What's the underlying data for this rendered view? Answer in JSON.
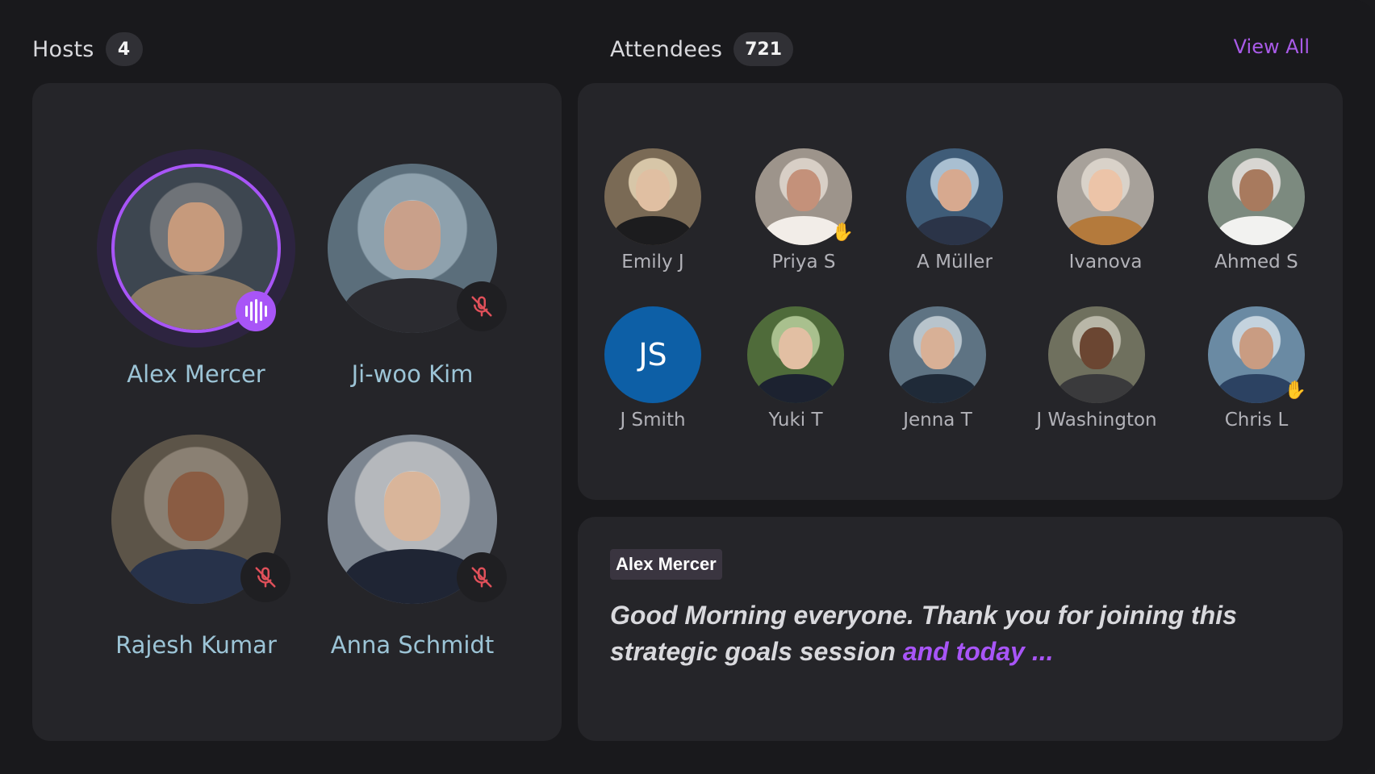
{
  "hosts": {
    "title": "Hosts",
    "count": "4",
    "items": [
      {
        "name": "Alex Mercer",
        "status": "speaking"
      },
      {
        "name": "Ji-woo Kim",
        "status": "muted"
      },
      {
        "name": "Rajesh Kumar",
        "status": "muted"
      },
      {
        "name": "Anna Schmidt",
        "status": "muted"
      }
    ]
  },
  "attendees": {
    "title": "Attendees",
    "count": "721",
    "view_all_label": "View All",
    "items": [
      {
        "name": "Emily J",
        "hand_raised": false
      },
      {
        "name": "Priya S",
        "hand_raised": true
      },
      {
        "name": "A Müller",
        "hand_raised": false
      },
      {
        "name": "Ivanova",
        "hand_raised": false
      },
      {
        "name": "Ahmed S",
        "hand_raised": false
      },
      {
        "name": "J Smith",
        "initials": "JS",
        "hand_raised": false
      },
      {
        "name": "Yuki T",
        "hand_raised": false
      },
      {
        "name": "Jenna T",
        "hand_raised": false
      },
      {
        "name": "J Washington",
        "hand_raised": false
      },
      {
        "name": "Chris L",
        "hand_raised": true
      }
    ]
  },
  "transcript": {
    "speaker": "Alex Mercer",
    "text": "Good Morning everyone. Thank you for joining this strategic goals session ",
    "highlight": "and today ..."
  },
  "icons": {
    "speaking": "audio-waveform-icon",
    "muted": "mic-off-icon",
    "hand": "raised-hand-icon"
  },
  "colors": {
    "accent": "#a855f7",
    "muted_icon": "#e0505a",
    "initials_bg": "#0d5fa6",
    "host_name": "#9cc4d6"
  }
}
